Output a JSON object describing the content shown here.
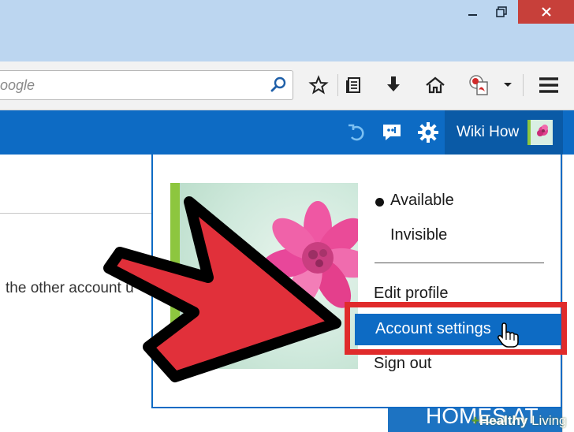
{
  "window": {
    "controls": [
      "minimize",
      "restore",
      "close"
    ],
    "close_color": "#c7403a",
    "titlebar_color": "#bcd6f0"
  },
  "toolbar": {
    "search_placeholder": "oogle",
    "icons": [
      "search-go-icon",
      "star-icon",
      "reading-list-icon",
      "download-icon",
      "home-icon",
      "pdf-icon",
      "dropdown-chevron-icon",
      "hamburger-menu-icon"
    ]
  },
  "appbar": {
    "accent": "#0d6bc4",
    "icons": [
      "refresh-icon",
      "chat-icon",
      "gear-icon"
    ],
    "user_name": "Wiki How"
  },
  "content": {
    "body_text": "the other account u"
  },
  "dropdown": {
    "status_available": "Available",
    "status_invisible": "Invisible",
    "edit_profile": "Edit profile",
    "account_settings": "Account settings",
    "sign_out": "Sign out",
    "highlight_color": "#e02b2b"
  },
  "ad": {
    "text": "HOMES AT"
  },
  "watermark": {
    "bold": "Healthy",
    "regular": " Living"
  }
}
